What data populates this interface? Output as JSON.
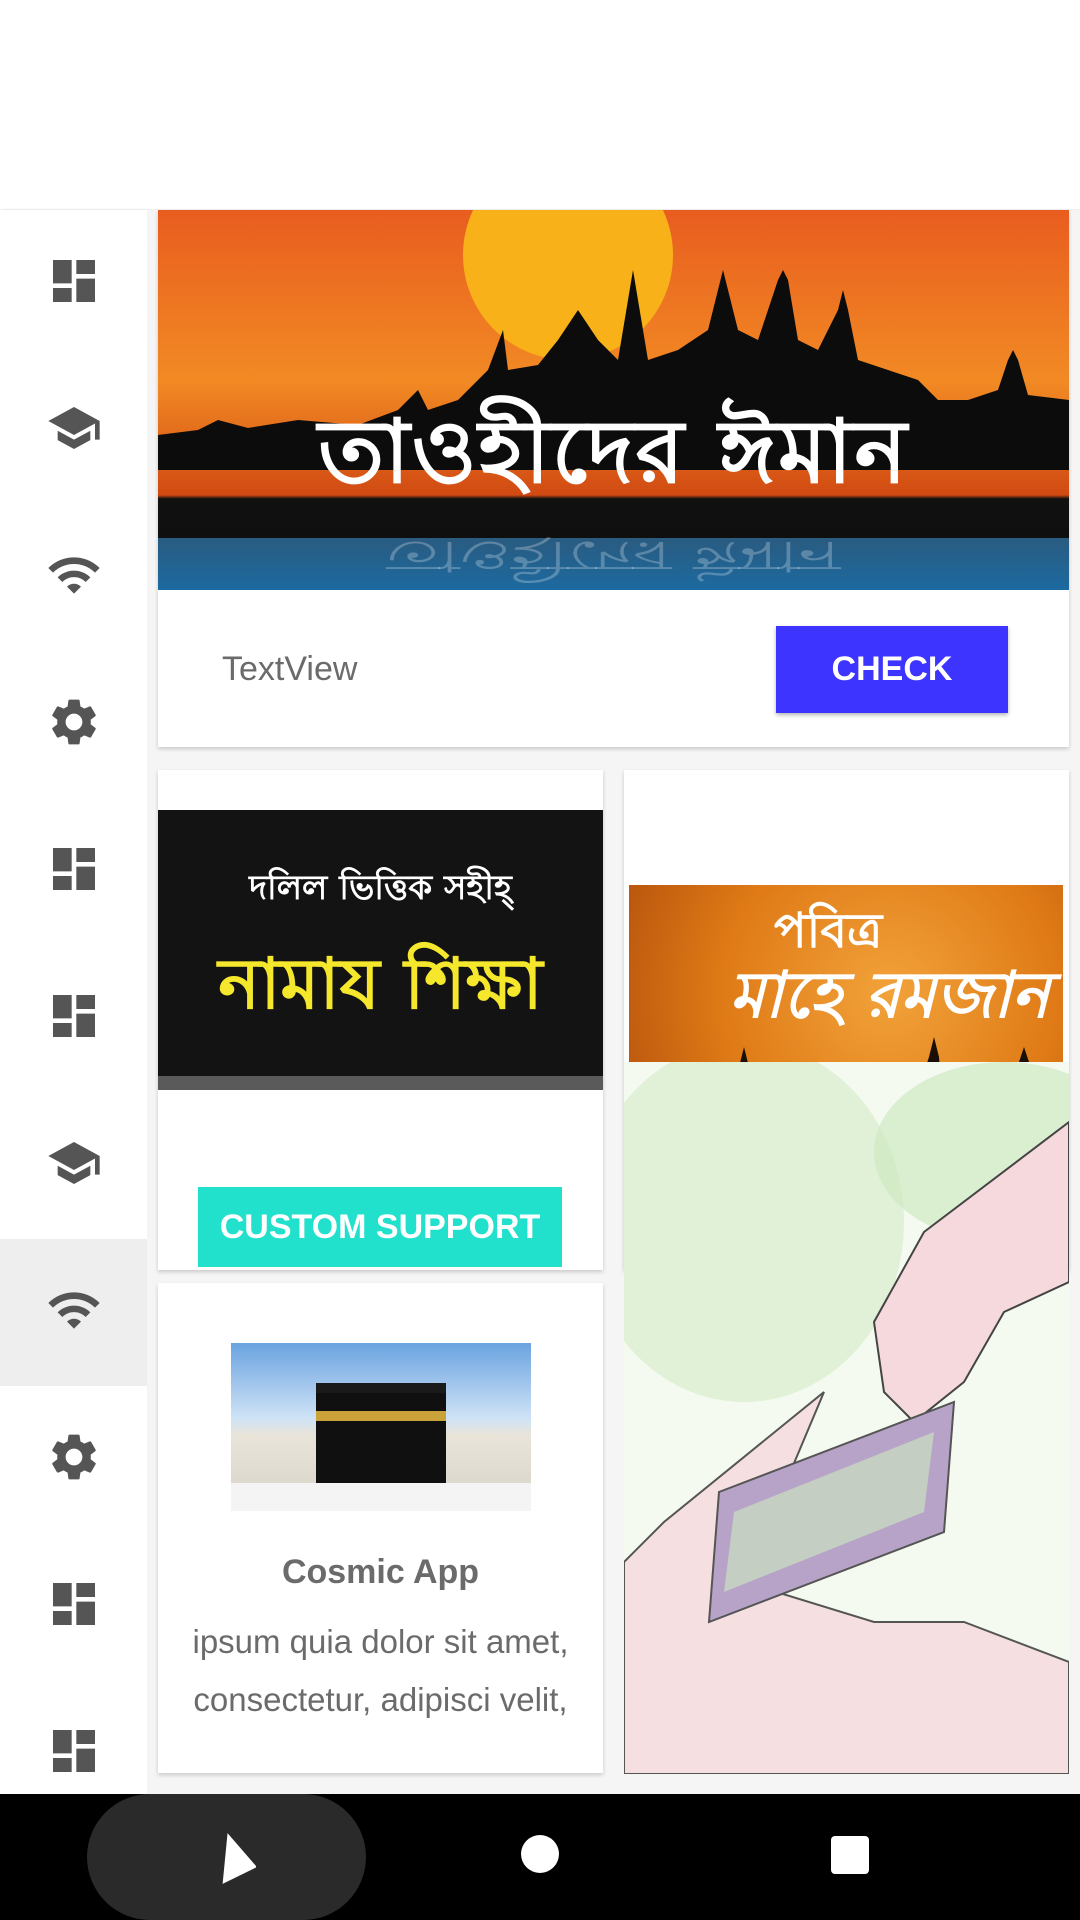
{
  "sidebar": {
    "items": [
      {
        "icon": "dashboard-icon"
      },
      {
        "icon": "school-icon"
      },
      {
        "icon": "wifi-icon"
      },
      {
        "icon": "settings-icon"
      },
      {
        "icon": "dashboard-icon"
      },
      {
        "icon": "dashboard-icon"
      },
      {
        "icon": "school-icon"
      },
      {
        "icon": "wifi-icon",
        "active": true
      },
      {
        "icon": "settings-icon"
      },
      {
        "icon": "dashboard-icon"
      },
      {
        "icon": "dashboard-icon"
      }
    ]
  },
  "banner_card": {
    "image_text": "তাওহীদের ঈমান",
    "textview": "TextView",
    "button_label": "CHECK",
    "button_color": "#3d34ff"
  },
  "namaz_card": {
    "image_line1": "দলিল ভিত্তিক সহীহ্",
    "image_line2": "নামায শিক্ষা",
    "button_label": "CUSTOM SUPPORT",
    "button_color": "#21e0cc"
  },
  "ramadan_card": {
    "image_line1": "পবিত্র",
    "image_line2": "মাহে রমজান"
  },
  "cosmic_card": {
    "title": "Cosmic App",
    "body_line1": "ipsum quia dolor sit amet,",
    "body_line2": "consectetur, adipisci velit,"
  },
  "navbar": {
    "back": "back-icon",
    "home": "home-icon",
    "recent": "recent-apps-icon"
  }
}
